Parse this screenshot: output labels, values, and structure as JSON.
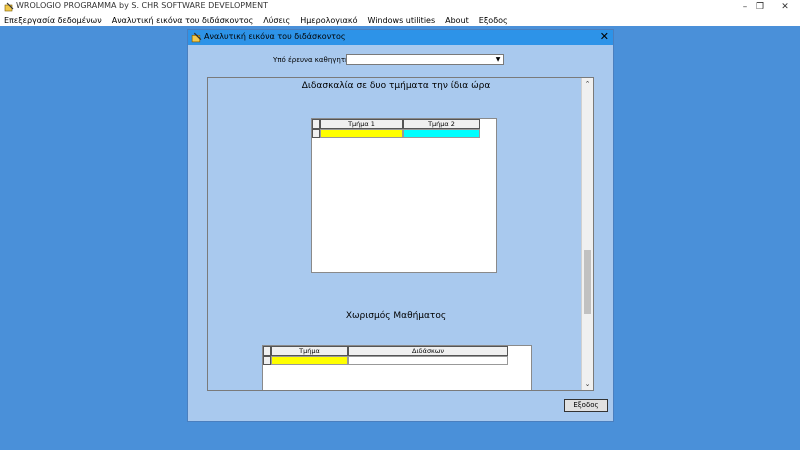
{
  "window": {
    "title": "WROLOGIO PROGRAMMA by S. CHR SOFTWARE DEVELOPMENT",
    "minimize": "–",
    "restore": "❐",
    "close": "✕"
  },
  "menu": [
    "Επεξεργασία δεδομένων",
    "Αναλυτική εικόνα του διδάσκοντος",
    "Λύσεις",
    "Ημερολογιακό",
    "Windows utilities",
    "About",
    "Εξοδος"
  ],
  "dialog": {
    "title": "Αναλυτική εικόνα του διδάσκοντος",
    "close": "✕",
    "professor_label": "Υπό έρευνα καθηγητής:",
    "professor_value": "",
    "section1_title": "Διδασκαλία σε δυο τμήματα την ίδια ώρα",
    "grid1": {
      "columns": [
        "Τμήμα 1",
        "Τμήμα 2"
      ],
      "row_colors": [
        "#ffff00",
        "#00ffff"
      ]
    },
    "section2_title": "Χωρισμός Μαθήματος",
    "grid2": {
      "columns": [
        "Τμήμα",
        "Διδάσκων"
      ],
      "row_colors": [
        "#ffff00",
        "#ffffff"
      ]
    },
    "scroll_up": "⌃",
    "scroll_down": "⌄",
    "exit_button": "Εξοδος"
  },
  "icons": {
    "app_icon": "pencil-book-icon",
    "dialog_icon": "pencil-book-icon"
  }
}
